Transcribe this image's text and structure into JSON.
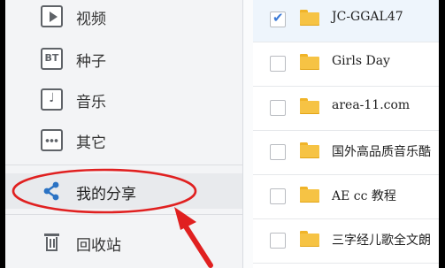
{
  "sidebar": {
    "items": [
      {
        "label": "视频",
        "icon": "video-icon"
      },
      {
        "label": "种子",
        "icon": "bt-icon"
      },
      {
        "label": "音乐",
        "icon": "music-icon"
      },
      {
        "label": "其它",
        "icon": "more-icon"
      },
      {
        "label": "我的分享",
        "icon": "share-icon"
      },
      {
        "label": "回收站",
        "icon": "trash-icon"
      }
    ]
  },
  "file_list": {
    "rows": [
      {
        "name": "JC-GGAL47",
        "checked": true
      },
      {
        "name": "Girls Day",
        "checked": false
      },
      {
        "name": "area-11.com",
        "checked": false
      },
      {
        "name": "国外高品质音乐酷",
        "checked": false
      },
      {
        "name": "AE cc 教程",
        "checked": false
      },
      {
        "name": "三字经儿歌全文朗",
        "checked": false
      }
    ]
  },
  "annotation": {
    "color": "#e02020",
    "target": "我的分享"
  },
  "colors": {
    "sidebar_bg": "#f3f4f6",
    "selected_row_bg": "#eef5fc",
    "folder": "#f6c344",
    "check": "#3c7ad6"
  }
}
